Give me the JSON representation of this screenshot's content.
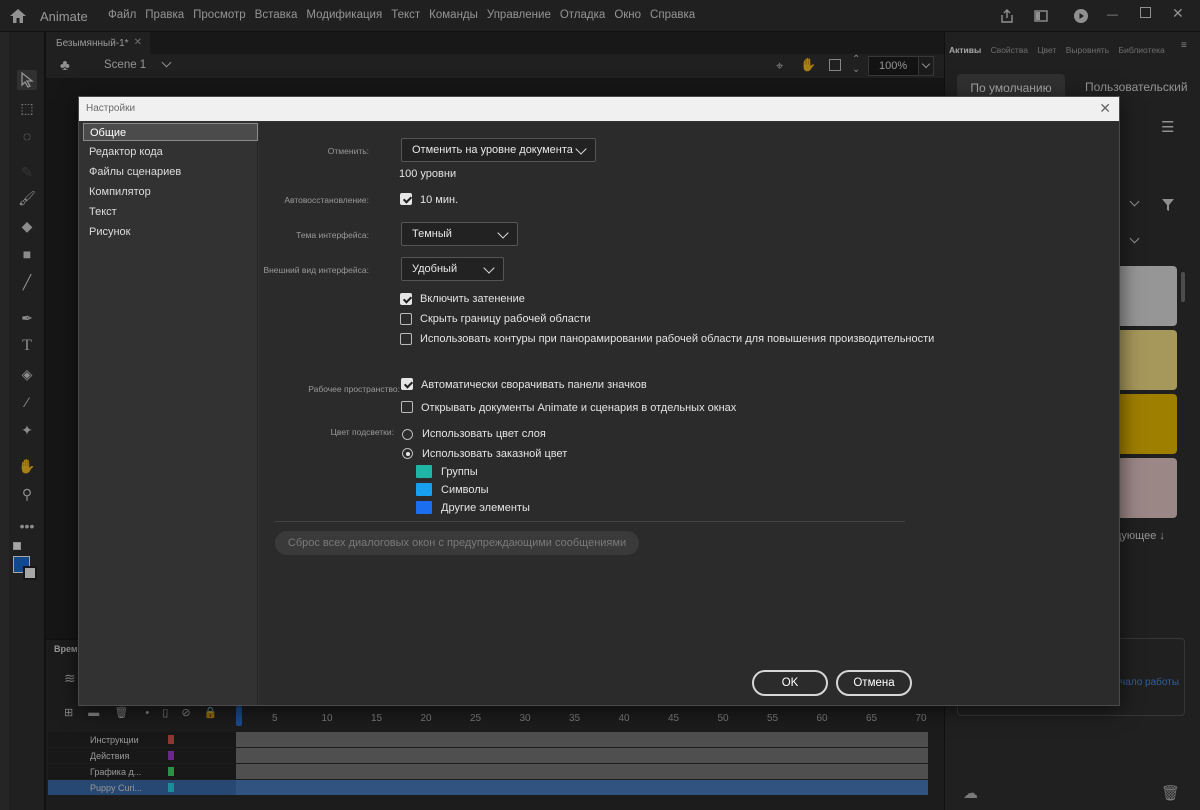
{
  "app": {
    "name": "Animate"
  },
  "menu": [
    "Файл",
    "Правка",
    "Просмотр",
    "Вставка",
    "Модификация",
    "Текст",
    "Команды",
    "Управление",
    "Отладка",
    "Окно",
    "Справка"
  ],
  "document": {
    "tab": "Безымянный-1*",
    "scene": "Scene 1",
    "zoom": "100%"
  },
  "right_panel": {
    "tabs": [
      "Активы",
      "Свойства",
      "Цвет",
      "Выровнять",
      "Библиотека"
    ],
    "btn_default": "По умолчанию",
    "btn_custom": "Пользовательский",
    "partial_next": "дующее",
    "partial_start": "чало работы"
  },
  "timeline": {
    "label_partial": "Време",
    "frames": [
      "5",
      "10",
      "15",
      "20",
      "25",
      "30",
      "35",
      "40",
      "45",
      "50",
      "55",
      "60",
      "65",
      "70"
    ],
    "layers": [
      {
        "name": "Инструкции",
        "color": "#e05252"
      },
      {
        "name": "Действия",
        "color": "#a040d0"
      },
      {
        "name": "Графика д...",
        "color": "#40e070"
      },
      {
        "name": "Puppy Curi...",
        "color": "#30d8f0"
      }
    ]
  },
  "dialog": {
    "title": "Настройки",
    "nav": [
      "Общие",
      "Редактор кода",
      "Файлы сценариев",
      "Компилятор",
      "Текст",
      "Рисунок"
    ],
    "undo_label": "Отменить:",
    "undo_value": "Отменить на уровне документа",
    "undo_levels": "100 уровни",
    "autosave_label": "Автовосстановление:",
    "autosave_value": "10 мин.",
    "theme_label": "Тема интерфейса:",
    "theme_value": "Темный",
    "look_label": "Внешний вид интерфейса:",
    "look_value": "Удобный",
    "cb_shading": "Включить затенение",
    "cb_hide_border": "Скрыть границу рабочей области",
    "cb_outlines": "Использовать контуры при панорамировании рабочей области для повышения производительности",
    "workspace_label": "Рабочее пространство:",
    "cb_autocollapse": "Автоматически сворачивать панели значков",
    "cb_separate_windows": "Открывать документы Animate и сценария в отдельных окнах",
    "highlight_label": "Цвет подсветки:",
    "rd_layer_color": "Использовать цвет слоя",
    "rd_custom_color": "Использовать заказной цвет",
    "swatches": [
      {
        "label": "Группы",
        "color": "#1fb6a6"
      },
      {
        "label": "Символы",
        "color": "#18a0f0"
      },
      {
        "label": "Другие элементы",
        "color": "#1c6ef0"
      }
    ],
    "reset_button": "Сброс всех диалоговых окон с предупреждающими сообщениями",
    "ok": "OK",
    "cancel": "Отмена"
  }
}
